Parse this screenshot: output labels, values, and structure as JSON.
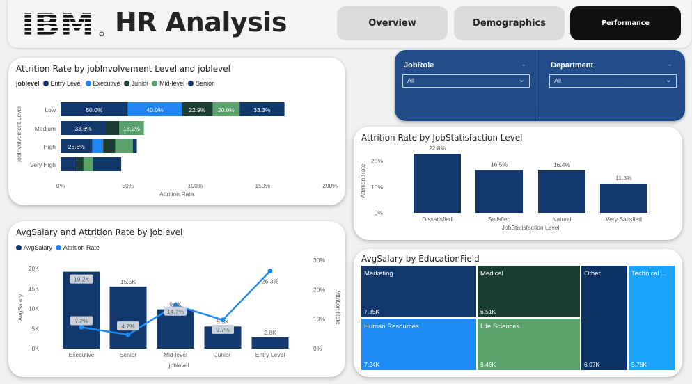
{
  "header": {
    "logo": "IBM",
    "title": "HR Analysis",
    "tabs": [
      {
        "label": "Overview"
      },
      {
        "label": "Demographics"
      },
      {
        "label": "Performance"
      }
    ]
  },
  "filters": {
    "jobrole": {
      "title": "JobRole",
      "value": "All"
    },
    "department": {
      "title": "Department",
      "value": "All"
    }
  },
  "colors": {
    "entry": "#12386e",
    "executive": "#2185f6",
    "junior": "#1c3d34",
    "midlevel": "#5aa36c",
    "senior": "#10396a",
    "navy": "#12386e",
    "navy_dark": "#0c3163",
    "light_blue": "#1e8bf5",
    "forest": "#1c3d34",
    "green": "#5aa36c",
    "sky": "#1aa3f8",
    "slicer_bg": "#234d8a"
  },
  "chart_data": [
    {
      "type": "bar",
      "orientation": "horizontal",
      "stacked": true,
      "title": "Attrition Rate by jobInvolvement Level and joblevel",
      "legend_title": "joblevel",
      "legend_position": "top-left",
      "categories": [
        "Low",
        "Medium",
        "High",
        "Very High"
      ],
      "series": [
        {
          "name": "Entry Level",
          "values": [
            50.0,
            33.6,
            23.6,
            12
          ]
        },
        {
          "name": "Executive",
          "values": [
            40.0,
            0,
            8,
            0
          ]
        },
        {
          "name": "Junior",
          "values": [
            22.9,
            10,
            9,
            5
          ]
        },
        {
          "name": "Mid-level",
          "values": [
            20.0,
            18.2,
            13,
            7
          ]
        },
        {
          "name": "Senior",
          "values": [
            33.3,
            0,
            3,
            21
          ]
        }
      ],
      "data_labels": [
        [
          "50.0%",
          "40.0%",
          "22.9%",
          "20.0%",
          "33.3%"
        ],
        [
          "33.6%",
          "",
          "",
          "18.2%",
          ""
        ],
        [
          "23.6%",
          "",
          "",
          "",
          ""
        ],
        [
          "",
          "",
          "",
          "",
          ""
        ]
      ],
      "xlabel": "Attrition Rate",
      "ylabel": "jobInvolvement Level",
      "xticks": [
        "0%",
        "50%",
        "100%",
        "150%",
        "200%"
      ],
      "xlim": [
        0,
        200
      ]
    },
    {
      "type": "bar",
      "title": "Attrition Rate by JobStatisfaction Level",
      "categories": [
        "Dissatisfied",
        "Satisfied",
        "Natural",
        "Very Satisfied"
      ],
      "values": [
        22.8,
        16.5,
        16.4,
        11.3
      ],
      "data_labels": [
        "22.8%",
        "16.5%",
        "16.4%",
        "11.3%"
      ],
      "xlabel": "JobStatisfaction Level",
      "ylabel": "Attrition Rate",
      "yticks": [
        "0%",
        "10%",
        "20%"
      ],
      "ylim": [
        0,
        25
      ]
    },
    {
      "type": "bar",
      "combo": "bar-line",
      "title": "AvgSalary and Attrition Rate by joblevel",
      "legend_position": "top-left",
      "categories": [
        "Executive",
        "Senior",
        "Mid-level",
        "Junior",
        "Entry Level"
      ],
      "series": [
        {
          "name": "AvgSalary",
          "type": "bar",
          "values": [
            19200,
            15500,
            9800,
            5500,
            2800
          ],
          "data_labels": [
            "19.2K",
            "15.5K",
            "9.8K",
            "5.5K",
            "2.8K"
          ]
        },
        {
          "name": "Attrition Rate",
          "type": "line",
          "values": [
            7.2,
            4.7,
            14.7,
            9.7,
            26.3
          ],
          "data_labels": [
            "7.2%",
            "4.7%",
            "14.7%",
            "9.7%",
            "26.3%"
          ]
        }
      ],
      "xlabel": "joblevel",
      "ylabel": "AvgSalary",
      "y2label": "Attrition Rate",
      "yticks": [
        "0K",
        "5K",
        "10K",
        "15K",
        "20K"
      ],
      "y2ticks": [
        "0%",
        "10%",
        "20%",
        "30%"
      ],
      "ylim": [
        0,
        20000
      ],
      "y2lim": [
        0,
        30
      ]
    },
    {
      "type": "heatmap",
      "subtype": "treemap",
      "title": "AvgSalary by EducationField",
      "items": [
        {
          "name": "Marketing",
          "value": 7350,
          "label": "7.35K"
        },
        {
          "name": "Medical",
          "value": 6510,
          "label": "6.51K"
        },
        {
          "name": "Human Resources",
          "value": 7240,
          "label": "7.24K"
        },
        {
          "name": "Life Sciences",
          "value": 6460,
          "label": "6.46K"
        },
        {
          "name": "Other",
          "value": 6070,
          "label": "6.07K"
        },
        {
          "name": "Technical ...",
          "value": 5760,
          "label": "5.76K"
        }
      ]
    }
  ]
}
